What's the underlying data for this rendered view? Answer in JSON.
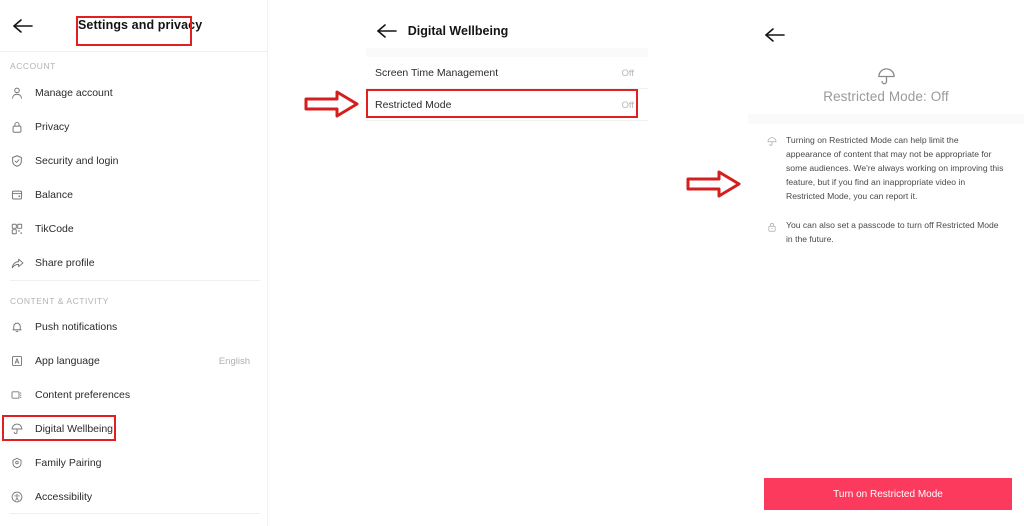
{
  "left_panel": {
    "back_icon": "back-arrow-icon",
    "title": "Settings and privacy",
    "sections": [
      {
        "label": "ACCOUNT",
        "items": [
          {
            "icon": "person-icon",
            "label": "Manage account",
            "value": ""
          },
          {
            "icon": "lock-icon",
            "label": "Privacy",
            "value": ""
          },
          {
            "icon": "shield-icon",
            "label": "Security and login",
            "value": ""
          },
          {
            "icon": "wallet-icon",
            "label": "Balance",
            "value": ""
          },
          {
            "icon": "qrcode-icon",
            "label": "TikCode",
            "value": ""
          },
          {
            "icon": "share-icon",
            "label": "Share profile",
            "value": ""
          }
        ]
      },
      {
        "label": "CONTENT & ACTIVITY",
        "items": [
          {
            "icon": "bell-icon",
            "label": "Push notifications",
            "value": ""
          },
          {
            "icon": "language-icon",
            "label": "App language",
            "value": "English"
          },
          {
            "icon": "screen-icon",
            "label": "Content preferences",
            "value": ""
          },
          {
            "icon": "umbrella-icon",
            "label": "Digital Wellbeing",
            "value": ""
          },
          {
            "icon": "family-icon",
            "label": "Family Pairing",
            "value": ""
          },
          {
            "icon": "accessibility-icon",
            "label": "Accessibility",
            "value": ""
          }
        ]
      }
    ]
  },
  "middle_panel": {
    "back_icon": "back-arrow-icon",
    "title": "Digital Wellbeing",
    "rows": [
      {
        "label": "Screen Time Management",
        "value": "Off"
      },
      {
        "label": "Restricted Mode",
        "value": "Off"
      }
    ]
  },
  "right_panel": {
    "back_icon": "back-arrow-icon",
    "hero_icon": "umbrella-icon",
    "hero_title": "Restricted Mode: Off",
    "notes": [
      {
        "icon": "umbrella-icon",
        "text": "Turning on Restricted Mode can help limit the appearance of content that may not be appropriate for some audiences. We're always working on improving this feature, but if you find an inappropriate video in Restricted Mode, you can report it."
      },
      {
        "icon": "lock-icon",
        "text": "You can also set a passcode to turn off Restricted Mode in the future."
      }
    ],
    "cta_label": "Turn on Restricted Mode"
  },
  "annotations": {
    "highlight_color": "#e02020",
    "arrow_color": "#d41f1f",
    "accent_color": "#fb3a5d",
    "arrows": [
      {
        "name": "arrow-to-restricted-mode-row"
      },
      {
        "name": "arrow-to-restricted-mode-detail"
      }
    ]
  }
}
